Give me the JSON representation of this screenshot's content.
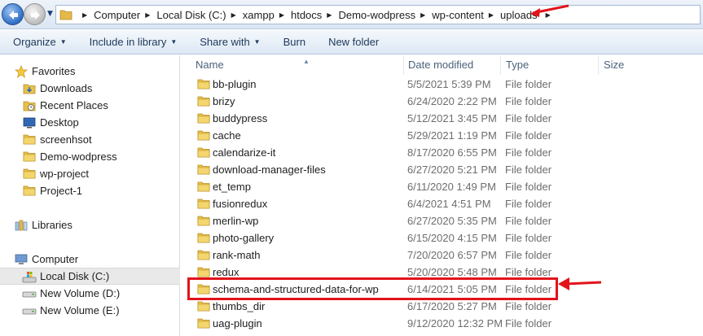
{
  "address_bar": {
    "breadcrumbs": [
      "Computer",
      "Local Disk (C:)",
      "xampp",
      "htdocs",
      "Demo-wodpress",
      "wp-content",
      "uploads"
    ]
  },
  "toolbar": {
    "organize_label": "Organize",
    "include_label": "Include in library",
    "share_label": "Share with",
    "burn_label": "Burn",
    "new_folder_label": "New folder"
  },
  "navigation": {
    "favorites_label": "Favorites",
    "favorites": [
      {
        "label": "Downloads",
        "icon": "downloads-folder-icon"
      },
      {
        "label": "Recent Places",
        "icon": "recent-places-icon"
      },
      {
        "label": "Desktop",
        "icon": "desktop-icon"
      },
      {
        "label": "screenhsot",
        "icon": "folder-icon"
      },
      {
        "label": "Demo-wodpress",
        "icon": "folder-icon"
      },
      {
        "label": "wp-project",
        "icon": "folder-icon"
      },
      {
        "label": "Project-1",
        "icon": "folder-icon"
      }
    ],
    "libraries_label": "Libraries",
    "computer_label": "Computer",
    "drives": [
      {
        "label": "Local Disk (C:)",
        "icon": "system-drive-icon",
        "selected": true
      },
      {
        "label": "New Volume (D:)",
        "icon": "drive-icon",
        "selected": false
      },
      {
        "label": "New Volume (E:)",
        "icon": "drive-icon",
        "selected": false
      }
    ]
  },
  "file_list": {
    "columns": {
      "name": "Name",
      "date": "Date modified",
      "type": "Type",
      "size": "Size"
    },
    "rows": [
      {
        "name": "bb-plugin",
        "date": "5/5/2021 5:39 PM",
        "type": "File folder"
      },
      {
        "name": "brizy",
        "date": "6/24/2020 2:22 PM",
        "type": "File folder"
      },
      {
        "name": "buddypress",
        "date": "5/12/2021 3:45 PM",
        "type": "File folder"
      },
      {
        "name": "cache",
        "date": "5/29/2021 1:19 PM",
        "type": "File folder"
      },
      {
        "name": "calendarize-it",
        "date": "8/17/2020 6:55 PM",
        "type": "File folder"
      },
      {
        "name": "download-manager-files",
        "date": "6/27/2020 5:21 PM",
        "type": "File folder"
      },
      {
        "name": "et_temp",
        "date": "6/11/2020 1:49 PM",
        "type": "File folder"
      },
      {
        "name": "fusionredux",
        "date": "6/4/2021 4:51 PM",
        "type": "File folder"
      },
      {
        "name": "merlin-wp",
        "date": "6/27/2020 5:35 PM",
        "type": "File folder"
      },
      {
        "name": "photo-gallery",
        "date": "6/15/2020 4:15 PM",
        "type": "File folder"
      },
      {
        "name": "rank-math",
        "date": "7/20/2020 6:57 PM",
        "type": "File folder"
      },
      {
        "name": "redux",
        "date": "5/20/2020 5:48 PM",
        "type": "File folder"
      },
      {
        "name": "schema-and-structured-data-for-wp",
        "date": "6/14/2021 5:05 PM",
        "type": "File folder"
      },
      {
        "name": "thumbs_dir",
        "date": "6/17/2020 5:27 PM",
        "type": "File folder"
      },
      {
        "name": "uag-plugin",
        "date": "9/12/2020 12:32 PM",
        "type": "File folder"
      }
    ]
  },
  "annotations": {
    "highlight_color": "#e2131b",
    "highlighted_row": "schema-and-structured-data-for-wp"
  },
  "colors": {
    "folder": "#e9c04a",
    "toolbar_text": "#1e395b"
  }
}
